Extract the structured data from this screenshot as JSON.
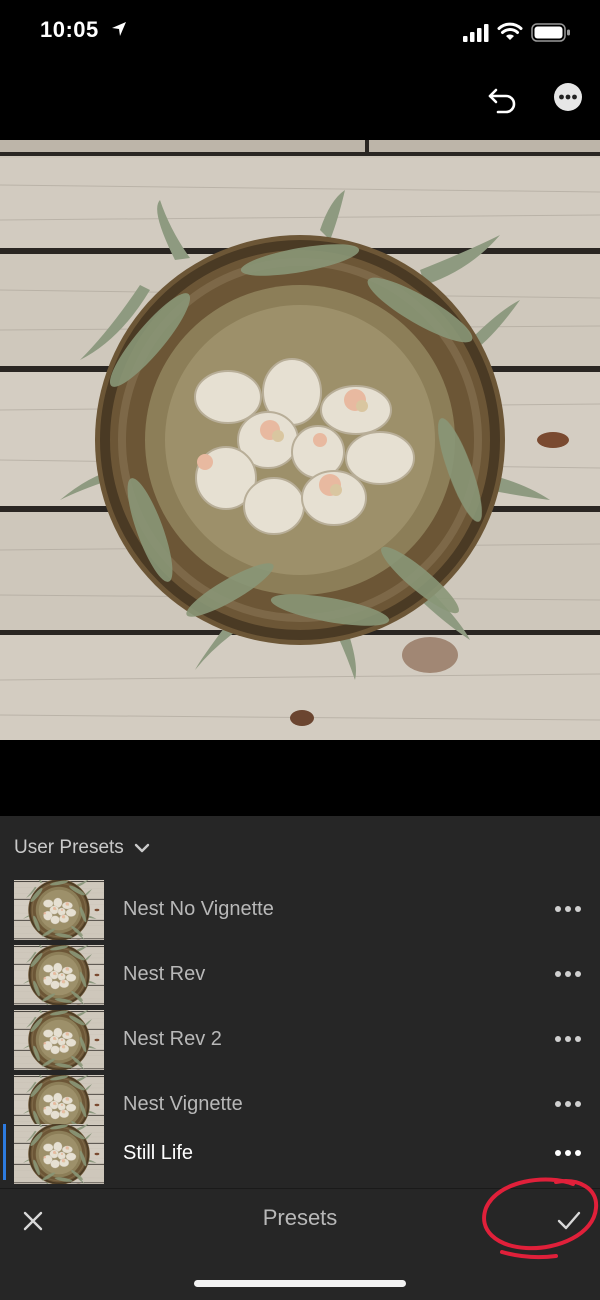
{
  "status_bar": {
    "time": "10:05"
  },
  "toolbar": {
    "undo_icon": "undo-icon",
    "more_icon": "more-icon"
  },
  "photo": {
    "subject": "bird-nest-with-paper-eggs"
  },
  "presets_panel": {
    "group_label": "User Presets",
    "items": [
      {
        "label": "Nest No Vignette",
        "selected": false
      },
      {
        "label": "Nest Rev",
        "selected": false
      },
      {
        "label": "Nest Rev 2",
        "selected": false
      },
      {
        "label": "Nest Vignette",
        "selected": false
      },
      {
        "label": "Still Life",
        "selected": true
      }
    ]
  },
  "bottom_bar": {
    "title": "Presets",
    "cancel_icon": "close-icon",
    "confirm_icon": "checkmark-icon"
  },
  "colors": {
    "accent": "#2d7be0",
    "panel_bg": "#262626",
    "annotation": "#e0203a"
  }
}
